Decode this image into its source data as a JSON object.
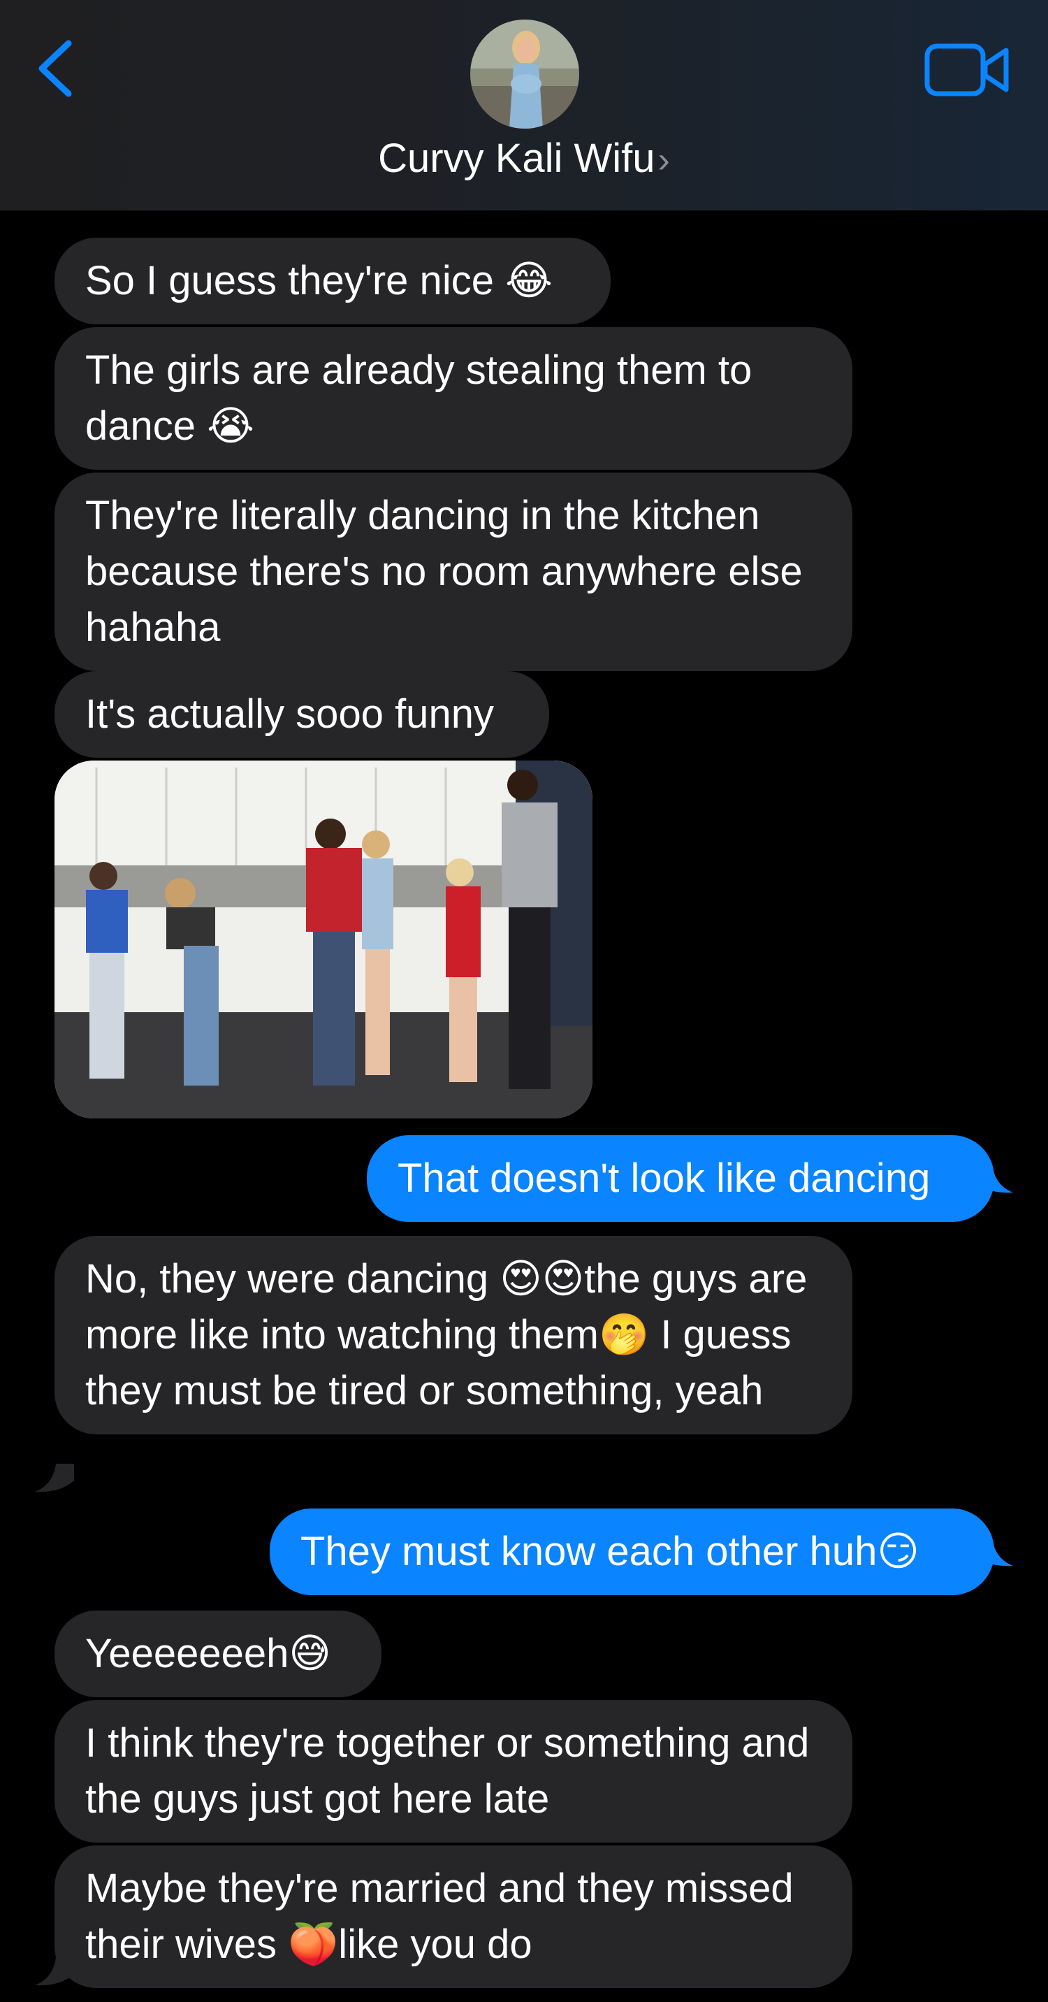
{
  "header": {
    "contact_name": "Curvy Kali Wifu",
    "chevron": "›",
    "back_icon": "chevron-left-icon",
    "video_icon": "video-camera-icon",
    "accent_color": "#0a84ff"
  },
  "messages": [
    {
      "side": "in",
      "text": "So I guess they're nice 😂"
    },
    {
      "side": "in",
      "text": "The girls are already stealing them to dance 😭"
    },
    {
      "side": "in",
      "text": "They're literally dancing in the kitchen because there's no room anywhere else hahaha"
    },
    {
      "side": "in",
      "text": "It's actually sooo funny"
    },
    {
      "side": "in",
      "type": "photo"
    },
    {
      "side": "out",
      "text": "That doesn't look like dancing"
    },
    {
      "side": "in",
      "text": "No, they were dancing 😍😍the guys are more like into watching them🤭 I guess they must be tired or something, yeah"
    },
    {
      "side": "out",
      "text": "They must know each other huh😏"
    },
    {
      "side": "in",
      "text": "Yeeeeeeeh😅"
    },
    {
      "side": "in",
      "text": "I think they're together or something and the guys just got here late"
    },
    {
      "side": "in",
      "text": "Maybe they're married and they missed their wives 🍑like you do"
    }
  ],
  "colors": {
    "incoming_bubble": "#262628",
    "outgoing_bubble": "#0a84ff",
    "background": "#000000"
  }
}
